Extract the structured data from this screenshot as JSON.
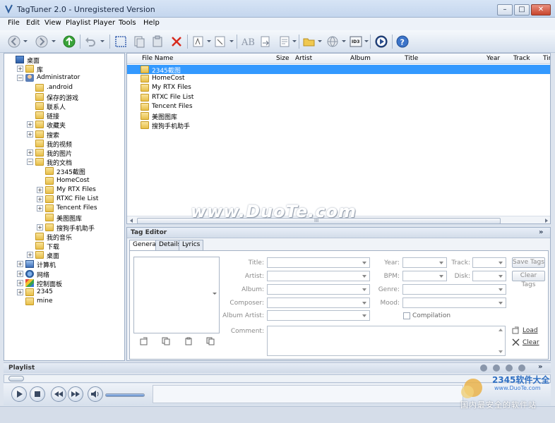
{
  "window": {
    "title": "TagTuner 2.0 - Unregistered Version",
    "controls": [
      "minimize",
      "maximize",
      "close"
    ]
  },
  "menu": [
    "File",
    "Edit",
    "View",
    "Playlist",
    "Player",
    "Tools",
    "Help"
  ],
  "toolbar": {
    "buttons": [
      "back-icon",
      "forward-icon",
      "refresh-up-icon",
      "undo-icon",
      "select-all-icon",
      "copy-tags-icon",
      "paste-tags-icon",
      "delete-icon",
      "rename-icon",
      "rename-folder-icon",
      "autonumber-icon",
      "tag-from-filename-icon",
      "text-file-icon",
      "folder-open-icon",
      "web-lookup-icon",
      "id3-icon",
      "play-circle-icon",
      "help-icon"
    ],
    "id3_label": "ID3"
  },
  "tree": [
    {
      "label": "桌面",
      "depth": 0,
      "expander": "",
      "icon": "desktop"
    },
    {
      "label": "库",
      "depth": 1,
      "expander": "+",
      "icon": "folder"
    },
    {
      "label": "Administrator",
      "depth": 1,
      "expander": "-",
      "icon": "user"
    },
    {
      "label": ".android",
      "depth": 2,
      "expander": "",
      "icon": "folder"
    },
    {
      "label": "保存的游戏",
      "depth": 2,
      "expander": "",
      "icon": "folder"
    },
    {
      "label": "联系人",
      "depth": 2,
      "expander": "",
      "icon": "folder"
    },
    {
      "label": "链接",
      "depth": 2,
      "expander": "",
      "icon": "folder"
    },
    {
      "label": "收藏夹",
      "depth": 2,
      "expander": "+",
      "icon": "folder"
    },
    {
      "label": "搜索",
      "depth": 2,
      "expander": "+",
      "icon": "folder"
    },
    {
      "label": "我的视频",
      "depth": 2,
      "expander": "",
      "icon": "folder"
    },
    {
      "label": "我的图片",
      "depth": 2,
      "expander": "+",
      "icon": "folder"
    },
    {
      "label": "我的文档",
      "depth": 2,
      "expander": "-",
      "icon": "folder"
    },
    {
      "label": "2345截图",
      "depth": 3,
      "expander": "",
      "icon": "folder"
    },
    {
      "label": "HomeCost",
      "depth": 3,
      "expander": "",
      "icon": "folder"
    },
    {
      "label": "My RTX Files",
      "depth": 3,
      "expander": "+",
      "icon": "folder"
    },
    {
      "label": "RTXC File List",
      "depth": 3,
      "expander": "+",
      "icon": "folder"
    },
    {
      "label": "Tencent Files",
      "depth": 3,
      "expander": "+",
      "icon": "folder"
    },
    {
      "label": "美图图库",
      "depth": 3,
      "expander": "",
      "icon": "folder"
    },
    {
      "label": "搜狗手机助手",
      "depth": 3,
      "expander": "+",
      "icon": "folder"
    },
    {
      "label": "我的音乐",
      "depth": 2,
      "expander": "",
      "icon": "folder"
    },
    {
      "label": "下载",
      "depth": 2,
      "expander": "",
      "icon": "folder"
    },
    {
      "label": "桌面",
      "depth": 2,
      "expander": "+",
      "icon": "folder"
    },
    {
      "label": "计算机",
      "depth": 1,
      "expander": "+",
      "icon": "computer"
    },
    {
      "label": "网络",
      "depth": 1,
      "expander": "+",
      "icon": "network"
    },
    {
      "label": "控制面板",
      "depth": 1,
      "expander": "+",
      "icon": "control-panel"
    },
    {
      "label": "2345",
      "depth": 1,
      "expander": "+",
      "icon": "folder"
    },
    {
      "label": "mine",
      "depth": 1,
      "expander": "",
      "icon": "folder"
    }
  ],
  "file_list": {
    "columns": [
      "File Name",
      "Size",
      "Artist",
      "Album",
      "Title",
      "Year",
      "Track",
      "Tim"
    ],
    "rows": [
      {
        "name": "2345截图",
        "selected": true
      },
      {
        "name": "HomeCost",
        "selected": false
      },
      {
        "name": "My RTX Files",
        "selected": false
      },
      {
        "name": "RTXC File List",
        "selected": false
      },
      {
        "name": "Tencent Files",
        "selected": false
      },
      {
        "name": "美图图库",
        "selected": false
      },
      {
        "name": "搜狗手机助手",
        "selected": false
      }
    ],
    "scroll_grip": "III"
  },
  "watermark": "www.DuoTe.com",
  "tag_editor": {
    "title": "Tag Editor",
    "collapse_glyph": "»",
    "tabs": [
      "General",
      "Details",
      "Lyrics"
    ],
    "fields": {
      "title": "Title:",
      "artist": "Artist:",
      "album": "Album:",
      "composer": "Composer:",
      "album_artist": "Album Artist:",
      "year": "Year:",
      "bpm": "BPM:",
      "genre": "Genre:",
      "mood": "Mood:",
      "track": "Track:",
      "disk": "Disk:",
      "comment": "Comment:",
      "compilation": "Compilation"
    },
    "save_tags": "Save Tags",
    "clear_tags": "Clear Tags",
    "load": "Load",
    "clear": "Clear"
  },
  "playlist": {
    "title": "Playlist",
    "collapse_glyph": "»"
  },
  "branding": {
    "logo_text": "2345软件大全",
    "url": "www.DuoTe.com",
    "slogan": "国内最安全的软件站"
  },
  "colors": {
    "selection": "#3399ff",
    "folder": "#e7bf4a",
    "close_button": "#c7452d"
  }
}
